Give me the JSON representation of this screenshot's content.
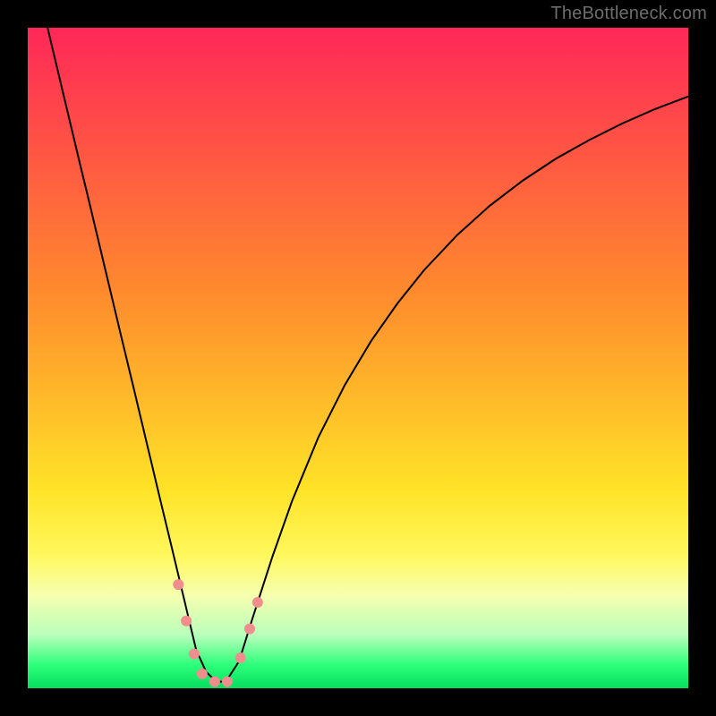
{
  "watermark": "TheBottleneck.com",
  "chart_data": {
    "type": "line",
    "title": "",
    "xlabel": "",
    "ylabel": "",
    "xlim": [
      0,
      100
    ],
    "ylim": [
      0,
      100
    ],
    "grid": false,
    "legend": false,
    "background_gradient": {
      "stops": [
        {
          "offset": 0.0,
          "color": "#ff2758"
        },
        {
          "offset": 0.4,
          "color": "#ff8a2d"
        },
        {
          "offset": 0.7,
          "color": "#ffe327"
        },
        {
          "offset": 0.8,
          "color": "#fff85e"
        },
        {
          "offset": 0.86,
          "color": "#f6ffb0"
        },
        {
          "offset": 0.92,
          "color": "#b8ffba"
        },
        {
          "offset": 0.965,
          "color": "#2cff7a"
        },
        {
          "offset": 1.0,
          "color": "#07de5f"
        }
      ]
    },
    "series": [
      {
        "name": "bottleneck-curve",
        "color": "#000000",
        "x": [
          3.0,
          4.0,
          5.0,
          6.0,
          7.0,
          8.0,
          9.0,
          10.0,
          12.0,
          14.0,
          16.0,
          18.0,
          20.0,
          22.0,
          24.0,
          25.5,
          27.0,
          28.5,
          30.0,
          32.0,
          34.0,
          37.0,
          40.0,
          44.0,
          48.0,
          52.0,
          56.0,
          60.0,
          65.0,
          70.0,
          75.0,
          80.0,
          85.0,
          90.0,
          95.0,
          100.0
        ],
        "y": [
          100.0,
          95.8,
          91.6,
          87.4,
          83.2,
          79.0,
          74.9,
          70.7,
          62.3,
          53.9,
          45.6,
          37.2,
          28.8,
          20.5,
          12.1,
          5.8,
          2.5,
          1.0,
          1.0,
          4.1,
          10.5,
          19.8,
          28.3,
          38.0,
          45.9,
          52.6,
          58.3,
          63.3,
          68.6,
          73.1,
          76.9,
          80.2,
          83.0,
          85.5,
          87.7,
          89.6
        ]
      }
    ],
    "markers": {
      "name": "highlight-dots",
      "color": "#f08d8d",
      "radius_px": 6,
      "points": [
        {
          "x": 22.8,
          "y": 15.7
        },
        {
          "x": 24.0,
          "y": 10.2
        },
        {
          "x": 25.2,
          "y": 5.2
        },
        {
          "x": 26.4,
          "y": 2.2
        },
        {
          "x": 28.3,
          "y": 1.0
        },
        {
          "x": 30.2,
          "y": 1.0
        },
        {
          "x": 32.2,
          "y": 4.6
        },
        {
          "x": 33.6,
          "y": 9.0
        },
        {
          "x": 34.8,
          "y": 13.0
        }
      ]
    }
  }
}
